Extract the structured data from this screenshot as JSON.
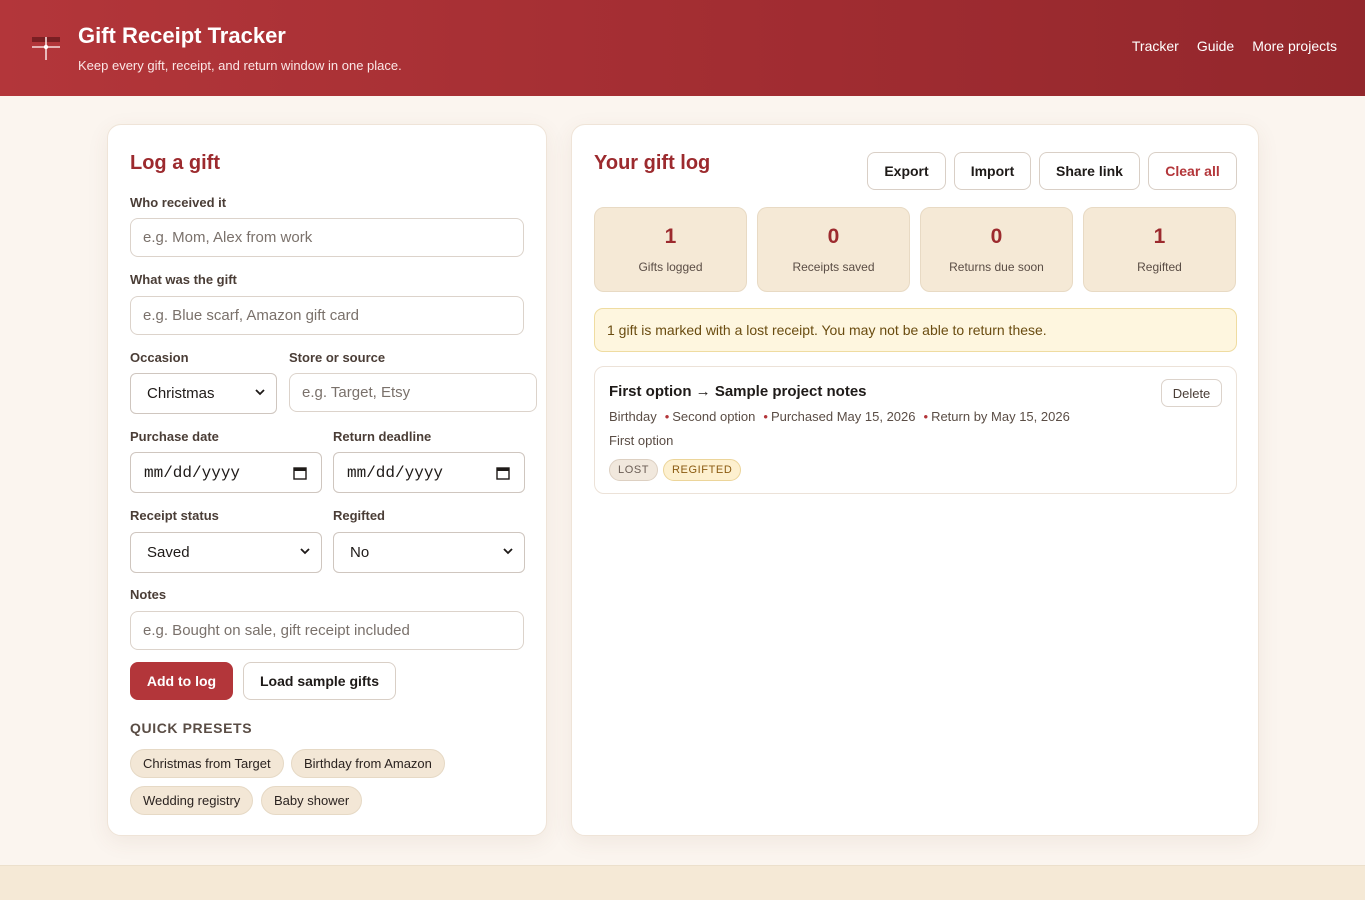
{
  "header": {
    "title": "Gift Receipt Tracker",
    "subtitle": "Keep every gift, receipt, and return window in one place.",
    "nav": [
      "Tracker",
      "Guide",
      "More projects"
    ]
  },
  "form": {
    "title": "Log a gift",
    "recipient": {
      "label": "Who received it",
      "placeholder": "e.g. Mom, Alex from work",
      "value": ""
    },
    "gift": {
      "label": "What was the gift",
      "placeholder": "e.g. Blue scarf, Amazon gift card",
      "value": ""
    },
    "occasion": {
      "label": "Occasion",
      "value": "Christmas"
    },
    "store": {
      "label": "Store or source",
      "placeholder": "e.g. Target, Etsy",
      "value": ""
    },
    "purchase_date": {
      "label": "Purchase date",
      "value": "mm/dd/yyyy"
    },
    "return_deadline": {
      "label": "Return deadline",
      "value": "mm/dd/yyyy"
    },
    "receipt_status": {
      "label": "Receipt status",
      "value": "Saved"
    },
    "regifted": {
      "label": "Regifted",
      "value": "No"
    },
    "notes": {
      "label": "Notes",
      "placeholder": "e.g. Bought on sale, gift receipt included",
      "value": ""
    },
    "add_button": "Add to log",
    "sample_button": "Load sample gifts",
    "presets_title": "QUICK PRESETS",
    "presets": [
      "Christmas from Target",
      "Birthday from Amazon",
      "Wedding registry",
      "Baby shower"
    ]
  },
  "log": {
    "title": "Your gift log",
    "actions": {
      "export": "Export",
      "import": "Import",
      "share": "Share link",
      "clear": "Clear all"
    },
    "stats": [
      {
        "value": "1",
        "label": "Gifts logged"
      },
      {
        "value": "0",
        "label": "Receipts saved"
      },
      {
        "value": "0",
        "label": "Returns due soon"
      },
      {
        "value": "1",
        "label": "Regifted"
      }
    ],
    "alert": "1 gift is marked with a lost receipt. You may not be able to return these.",
    "entries": [
      {
        "title": "First option → Sample project notes",
        "occasion": "Birthday",
        "store": "Second option",
        "purchased": "Purchased May 15, 2026",
        "return_by": "Return by May 15, 2026",
        "note": "First option",
        "tags": [
          "LOST",
          "REGIFTED"
        ],
        "delete_label": "Delete"
      }
    ]
  }
}
